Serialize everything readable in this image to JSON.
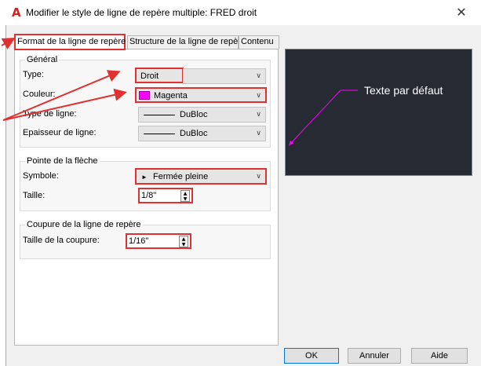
{
  "window": {
    "title": "Modifier le style de ligne de repère multiple: FRED droit",
    "close_glyph": "✕",
    "app_icon_glyph": "A"
  },
  "tabs": [
    {
      "label": "Format de la ligne de repère",
      "active": true
    },
    {
      "label": "Structure de la ligne de repère",
      "active": false
    },
    {
      "label": "Contenu",
      "active": false
    }
  ],
  "general": {
    "title": "Général",
    "type_label": "Type:",
    "type_value": "Droit",
    "color_label": "Couleur:",
    "color_value": "Magenta",
    "color_swatch": "#ff00ff",
    "linetype_label": "Type de ligne:",
    "linetype_value": "DuBloc",
    "lineweight_label": "Epaisseur de ligne:",
    "lineweight_value": "DuBloc"
  },
  "arrowhead": {
    "title": "Pointe de la flèche",
    "symbol_label": "Symbole:",
    "symbol_value": "Fermée pleine",
    "symbol_glyph": "►",
    "size_label": "Taille:",
    "size_value": "1/8\""
  },
  "landing_break": {
    "title": "Coupure de la ligne de repère",
    "break_size_label": "Taille de la coupure:",
    "break_size_value": "1/16\""
  },
  "preview": {
    "text": "Texte par défaut",
    "bg_color": "#262b33",
    "leader_color": "#ff00ff"
  },
  "buttons": {
    "ok": "OK",
    "cancel": "Annuler",
    "help": "Aide"
  },
  "glyphs": {
    "chevron": "∨",
    "spin_up": "▲",
    "spin_down": "▼"
  },
  "annotation_color": "#e03030"
}
